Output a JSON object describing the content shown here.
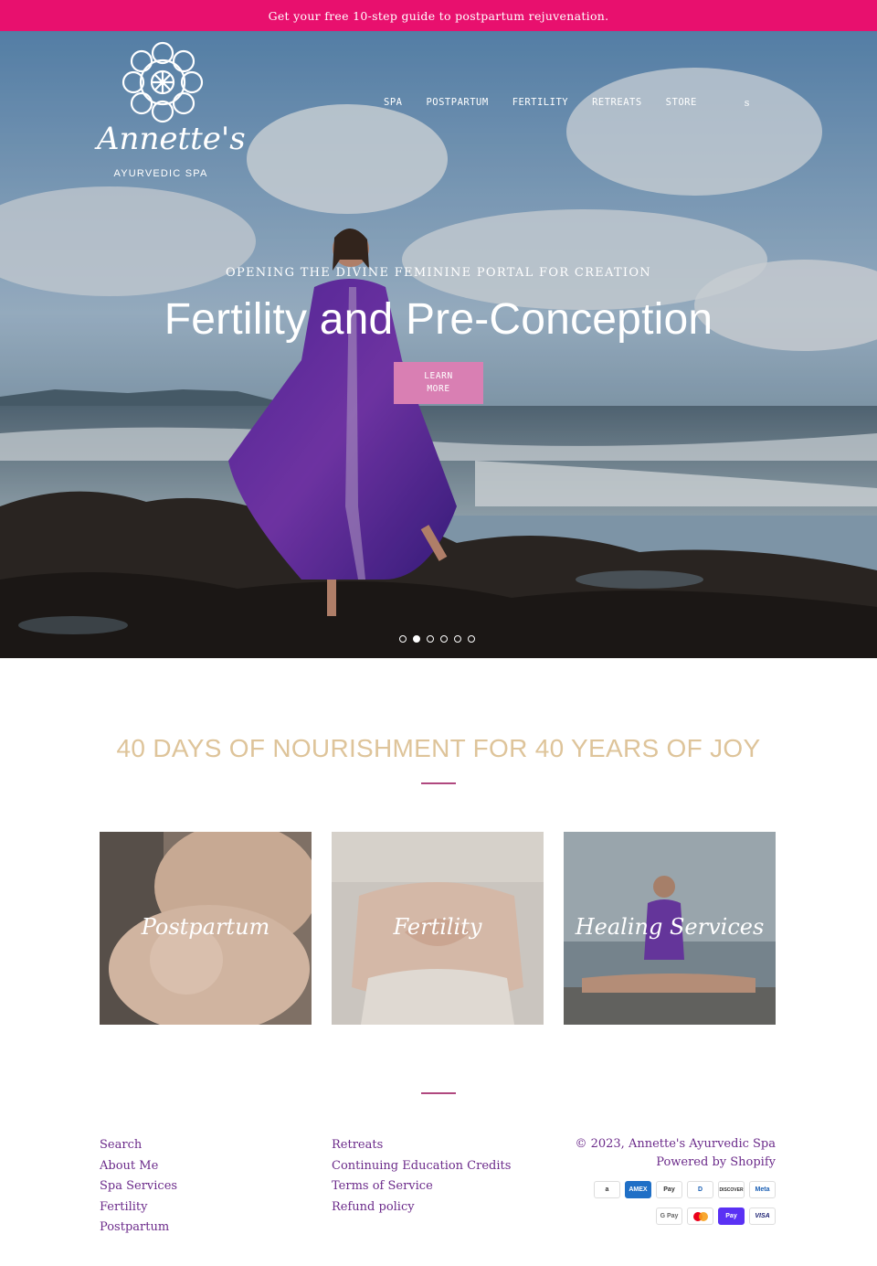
{
  "announcement": {
    "text": "Get your free 10-step guide to postpartum rejuvenation."
  },
  "header": {
    "logo": {
      "name": "Annette's",
      "sub": "AYURVEDIC SPA"
    },
    "nav": [
      "SPA",
      "POSTPARTUM",
      "FERTILITY",
      "RETREATS",
      "STORE"
    ],
    "search_label": "s"
  },
  "hero": {
    "eyebrow": "OPENING THE DIVINE FEMININE PORTAL FOR CREATION",
    "title": "Fertility and Pre-Conception",
    "button_label": "LEARN MORE",
    "slides": 6,
    "active_slide": 2
  },
  "tagline": "40 DAYS OF NOURISHMENT FOR 40 YEARS OF JOY",
  "collections": [
    "Postpartum",
    "Fertility",
    "Healing Services"
  ],
  "footer": {
    "col1": [
      "Search",
      "About Me",
      "Spa Services",
      "Fertility",
      "Postpartum"
    ],
    "col2": [
      "Retreats",
      "Continuing Education Credits",
      "Terms of Service",
      "Refund policy"
    ],
    "copyright": "© 2023, Annette's Ayurvedic Spa",
    "powered": "Powered by Shopify",
    "payments_row1": [
      "a",
      "AMEX",
      "Pay",
      "D",
      "DISCOVER",
      "Meta"
    ],
    "payments_row2": [
      "G Pay",
      "MC",
      "Pay",
      "VISA"
    ]
  },
  "colors": {
    "accent": "#e8106e",
    "button": "#d97fb3",
    "tagline": "#dec49a",
    "link": "#6b2a8a"
  }
}
